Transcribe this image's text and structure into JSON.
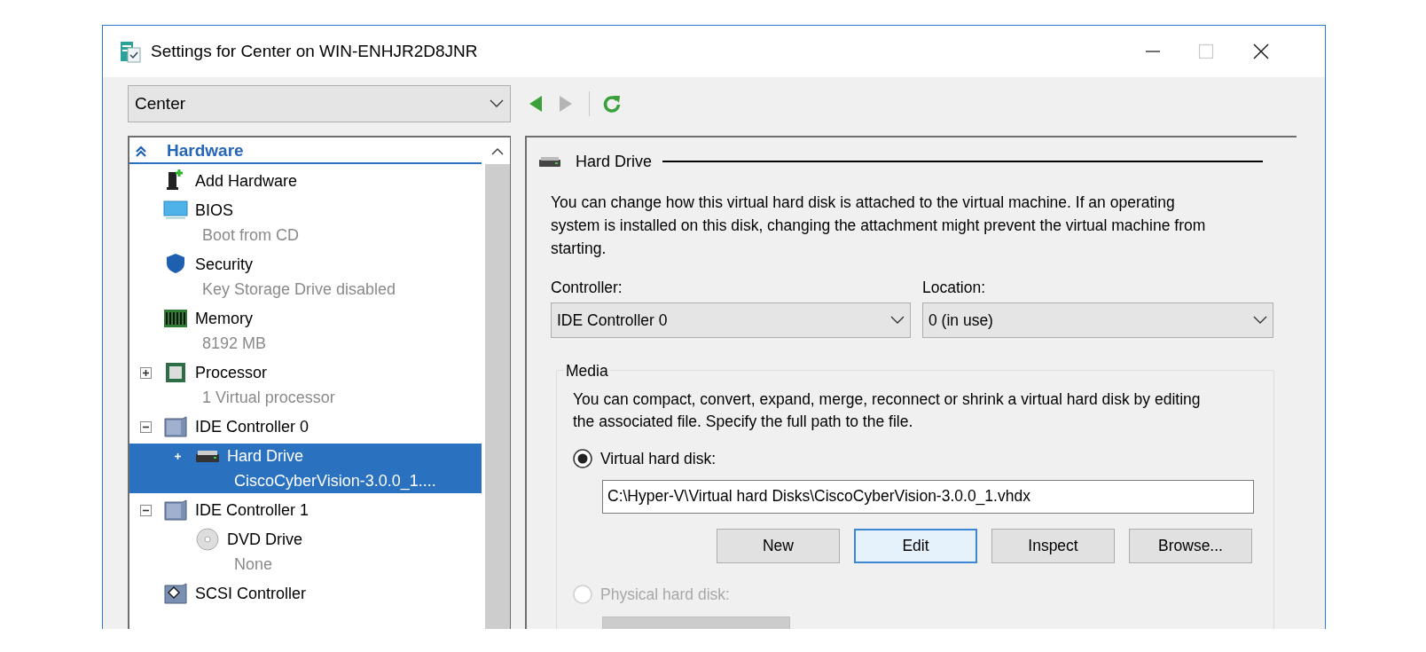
{
  "window": {
    "title": "Settings for Center on WIN-ENHJR2D8JNR"
  },
  "vm_selector": {
    "value": "Center"
  },
  "toolbar": [
    {
      "kind": "back",
      "disabled": false
    },
    {
      "kind": "forward",
      "disabled": true
    },
    {
      "kind": "refresh",
      "disabled": false
    }
  ],
  "tree": {
    "section": {
      "label": "Hardware",
      "expanded": true
    },
    "items": [
      {
        "kind": "add-hardware",
        "label": "Add Hardware",
        "selected": false
      },
      {
        "kind": "bios",
        "label": "BIOS",
        "detail": "Boot from CD",
        "selected": false
      },
      {
        "kind": "security",
        "label": "Security",
        "detail": "Key Storage Drive disabled",
        "selected": false
      },
      {
        "kind": "memory",
        "label": "Memory",
        "detail": "8192 MB",
        "selected": false
      },
      {
        "kind": "processor",
        "label": "Processor",
        "detail": "1 Virtual processor",
        "expanded": false,
        "selected": false
      },
      {
        "kind": "ide-controller",
        "label": "IDE Controller 0",
        "expanded": true,
        "selected": false,
        "children": [
          {
            "kind": "hard-drive",
            "label": "Hard Drive",
            "detail": "CiscoCyberVision-3.0.0_1....",
            "expanded": false,
            "selected": true
          }
        ]
      },
      {
        "kind": "ide-controller",
        "label": "IDE Controller 1",
        "expanded": true,
        "selected": false,
        "children": [
          {
            "kind": "dvd-drive",
            "label": "DVD Drive",
            "detail": "None",
            "selected": false
          }
        ]
      },
      {
        "kind": "scsi-controller",
        "label": "SCSI Controller",
        "selected": false
      }
    ]
  },
  "panel": {
    "heading": "Hard Drive",
    "description": "You can change how this virtual hard disk is attached to the virtual machine. If an operating system is installed on this disk, changing the attachment might prevent the virtual machine from starting.",
    "controller": {
      "label": "Controller:",
      "value": "IDE Controller 0"
    },
    "location": {
      "label": "Location:",
      "value": "0 (in use)"
    },
    "media": {
      "label": "Media",
      "description": "You can compact, convert, expand, merge, reconnect or shrink a virtual hard disk by editing the associated file. Specify the full path to the file.",
      "options": [
        {
          "kind": "virtual",
          "label": "Virtual hard disk:",
          "selected": true,
          "disabled": false
        },
        {
          "kind": "physical",
          "label": "Physical hard disk:",
          "selected": false,
          "disabled": true
        }
      ],
      "path": {
        "value": "C:\\Hyper-V\\Virtual hard Disks\\CiscoCyberVision-3.0.0_1.vhdx"
      },
      "buttons": [
        {
          "label": "New",
          "focused": false
        },
        {
          "label": "Edit",
          "focused": true
        },
        {
          "label": "Inspect",
          "focused": false
        },
        {
          "label": "Browse...",
          "focused": false
        }
      ]
    }
  }
}
